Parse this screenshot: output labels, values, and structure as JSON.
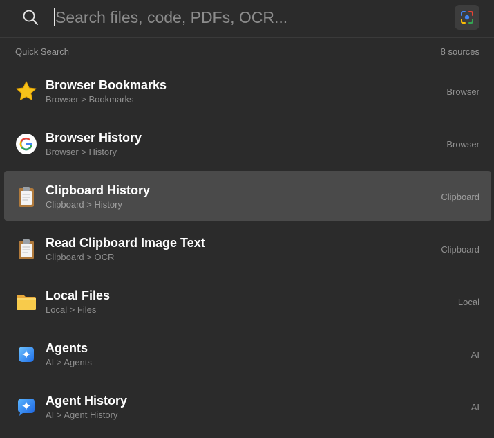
{
  "search": {
    "placeholder": "Search files, code, PDFs, OCR...",
    "value": ""
  },
  "section": {
    "title": "Quick Search",
    "sources_count": "8 sources"
  },
  "results": [
    {
      "title": "Browser Bookmarks",
      "path": "Browser > Bookmarks",
      "source": "Browser",
      "icon": "star-icon"
    },
    {
      "title": "Browser History",
      "path": "Browser > History",
      "source": "Browser",
      "icon": "google-icon"
    },
    {
      "title": "Clipboard History",
      "path": "Clipboard > History",
      "source": "Clipboard",
      "icon": "clipboard-icon",
      "selected": true
    },
    {
      "title": "Read Clipboard Image Text",
      "path": "Clipboard > OCR",
      "source": "Clipboard",
      "icon": "clipboard-icon"
    },
    {
      "title": "Local Files",
      "path": "Local > Files",
      "source": "Local",
      "icon": "folder-icon"
    },
    {
      "title": "Agents",
      "path": "AI > Agents",
      "source": "AI",
      "icon": "sparkle-icon"
    },
    {
      "title": "Agent History",
      "path": "AI > Agent History",
      "source": "AI",
      "icon": "sparkle-bubble-icon"
    }
  ],
  "colors": {
    "background": "#2b2b2b",
    "selected_row": "#4a4a4a",
    "star": "#f7c21a",
    "folder": "#f8cb4b",
    "sparkle": "#2f8ef5"
  }
}
